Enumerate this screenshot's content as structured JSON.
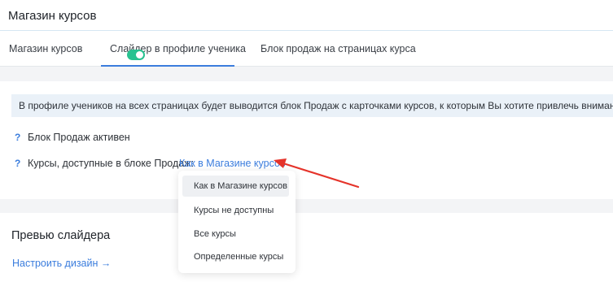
{
  "header": {
    "title": "Магазин курсов"
  },
  "tabs": [
    {
      "label": "Магазин курсов"
    },
    {
      "label": "Слайдер в профиле ученика"
    },
    {
      "label": "Блок продаж на страницах курса"
    }
  ],
  "info": {
    "text": "В профиле учеников на всех страницах будет выводится блок Продаж с карточками курсов, к которым Вы хотите привлечь внимание."
  },
  "settings": {
    "help_mark": "?",
    "active_label": "Блок Продаж активен",
    "active_on": true,
    "courses_label": "Курсы, доступные в блоке Продаж:",
    "courses_value": "Как в Магазине курсов"
  },
  "dropdown": {
    "options": [
      "Как в Магазине курсов",
      "Курсы не доступны",
      "Все курсы",
      "Определенные курсы"
    ]
  },
  "preview": {
    "title": "Превью слайдера",
    "design_link": "Настроить дизайн →"
  },
  "colors": {
    "accent": "#3b7ddd",
    "toggle_on": "#27c290",
    "annotation_arrow": "#e5332a"
  }
}
